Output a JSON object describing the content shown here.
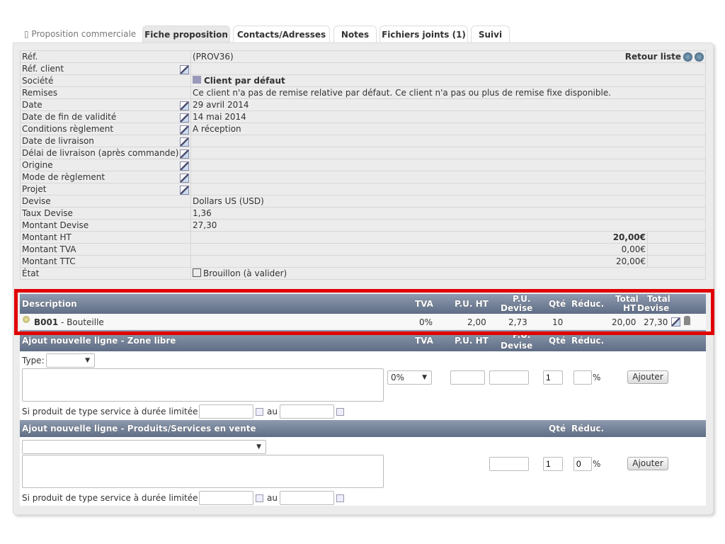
{
  "tabs": [
    {
      "label": "Proposition commerciale"
    },
    {
      "label": "Fiche proposition"
    },
    {
      "label": "Contacts/Adresses"
    },
    {
      "label": "Notes"
    },
    {
      "label": "Fichiers joints (1)"
    },
    {
      "label": "Suivi"
    }
  ],
  "back_label": "Retour liste",
  "info": [
    {
      "label": "Réf.",
      "value": "(PROV36)",
      "edit": false
    },
    {
      "label": "Réf. client",
      "value": "",
      "edit": true
    },
    {
      "label": "Société",
      "value": "Client par défaut",
      "edit": false
    },
    {
      "label": "Remises",
      "value": "Ce client n'a pas de remise relative par défaut. Ce client n'a pas ou plus de remise fixe disponible.",
      "edit": false
    },
    {
      "label": "Date",
      "value": "29 avril 2014",
      "edit": true
    },
    {
      "label": "Date de fin de validité",
      "value": "14 mai 2014",
      "edit": true
    },
    {
      "label": "Conditions règlement",
      "value": "A réception",
      "edit": true
    },
    {
      "label": "Date de livraison",
      "value": "",
      "edit": true
    },
    {
      "label": "Délai de livraison (après commande)",
      "value": "",
      "edit": true
    },
    {
      "label": "Origine",
      "value": "",
      "edit": true
    },
    {
      "label": "Mode de règlement",
      "value": "",
      "edit": true
    },
    {
      "label": "Projet",
      "value": "",
      "edit": true
    },
    {
      "label": "Devise",
      "value": "Dollars US (USD)",
      "edit": false
    },
    {
      "label": "Taux Devise",
      "value": "1,36",
      "edit": false
    },
    {
      "label": "Montant Devise",
      "value": "27,30",
      "edit": false
    }
  ],
  "amounts": [
    {
      "label": "Montant HT",
      "value": "20,00€"
    },
    {
      "label": "Montant TVA",
      "value": "0,00€"
    },
    {
      "label": "Montant TTC",
      "value": "20,00€"
    }
  ],
  "state": {
    "label": "État",
    "value": "Brouillon (à valider)"
  },
  "lines_header": {
    "description": "Description",
    "tva": "TVA",
    "pu_ht": "P.U. HT",
    "pu_devise_1": "P.U.",
    "pu_devise_2": "Devise",
    "qty": "Qté",
    "reduc": "Réduc.",
    "total_ht_1": "Total",
    "total_ht_2": "HT",
    "total_devise_1": "Total",
    "total_devise_2": "Devise"
  },
  "line": {
    "ref": "B001",
    "label": " - Bouteille",
    "tva": "0%",
    "pu_ht": "2,00",
    "pu_devise": "2,73",
    "qty": "10",
    "total_ht": "20,00",
    "total_devise": "27,30"
  },
  "free_zone": {
    "title": "Ajout nouvelle ligne - Zone libre",
    "type_label": "Type:",
    "tva_value": "0%",
    "qty_value": "1",
    "pct": "%",
    "add_label": "Ajouter",
    "service_label": "Si produit de type service à durée limitée : Du",
    "au": "au"
  },
  "products_zone": {
    "title": "Ajout nouvelle ligne - Produits/Services en vente",
    "qty": "Qté",
    "reduc": "Réduc.",
    "qty_value": "1",
    "reduc_value": "0",
    "pct": "%",
    "add_label": "Ajouter",
    "service_label": "Si produit de type service à durée limitée : Du",
    "au": "au"
  },
  "colors": {
    "highlight": "#e00000",
    "header": "#6f7d93"
  }
}
